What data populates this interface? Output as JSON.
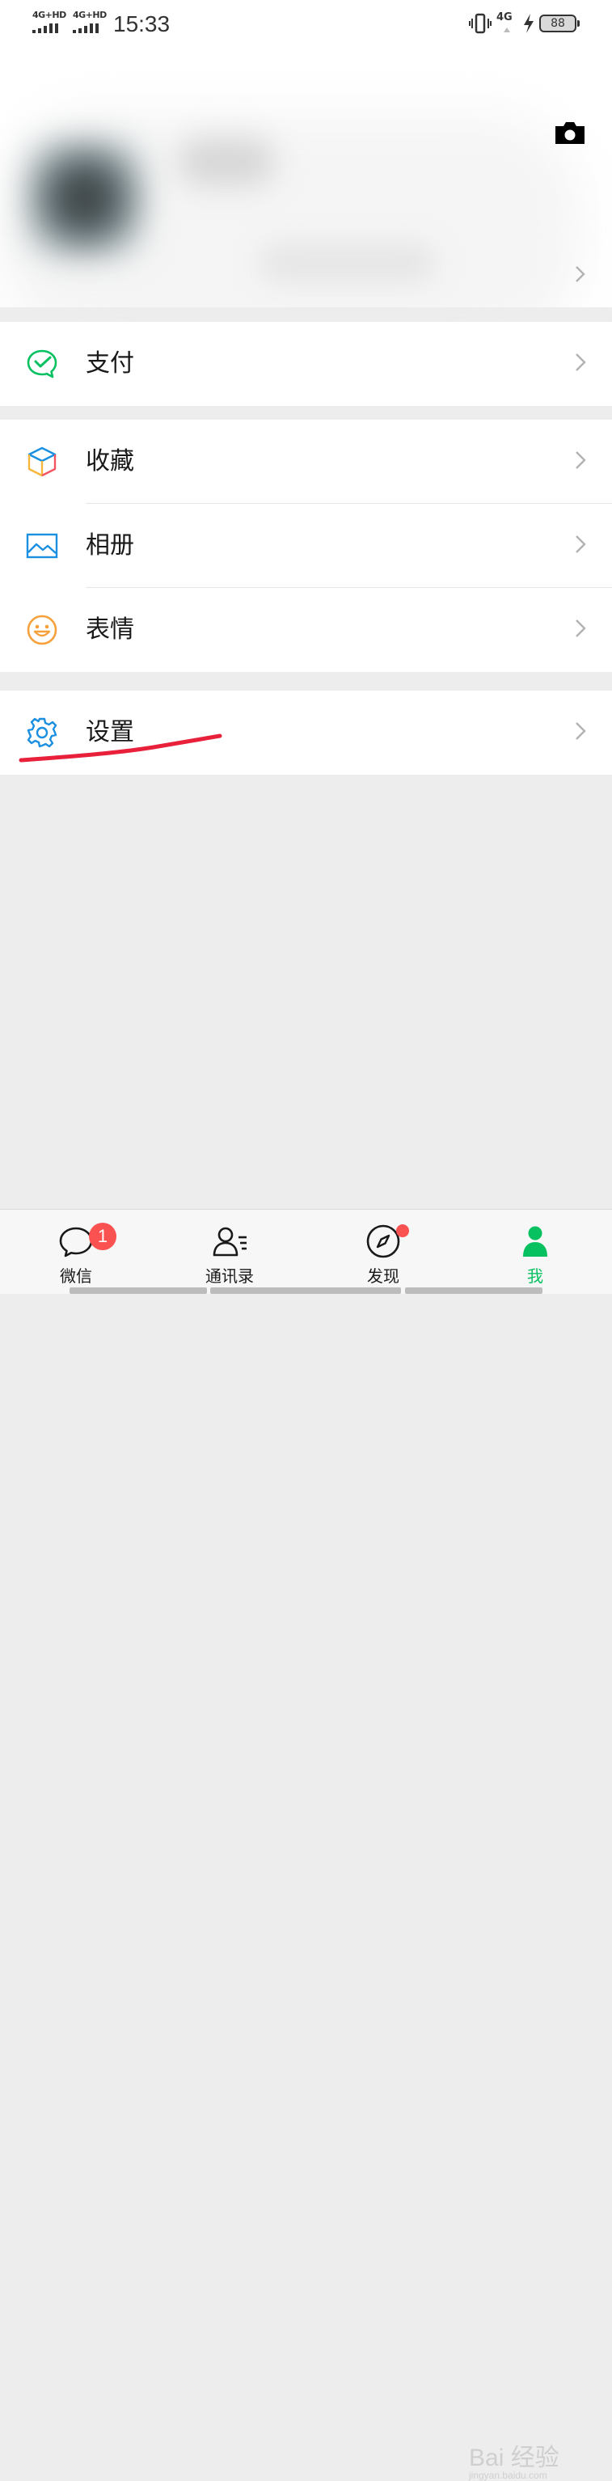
{
  "status_bar": {
    "sim1_network": "4G+HD",
    "sim2_network": "4G+HD",
    "time": "15:33",
    "data_network": "4G",
    "battery_level": "88"
  },
  "menu": {
    "pay_label": "支付",
    "favorites_label": "收藏",
    "album_label": "相册",
    "stickers_label": "表情",
    "settings_label": "设置"
  },
  "tabbar": {
    "tabs": [
      {
        "label": "微信",
        "badge": "1"
      },
      {
        "label": "通讯录"
      },
      {
        "label": "发现",
        "dot": true
      },
      {
        "label": "我",
        "active": true
      }
    ],
    "active_color": "#07c160"
  },
  "watermark": {
    "text": "Bai 经验",
    "url": "jingyan.baidu.com"
  },
  "colors": {
    "accent": "#07c160",
    "badge": "#fa5151",
    "background": "#ededed",
    "annotation": "#e8203a"
  },
  "icons": [
    "camera-icon",
    "pay-icon",
    "favorites-cube-icon",
    "album-icon",
    "stickers-smile-icon",
    "settings-gear-icon",
    "chat-icon",
    "contacts-icon",
    "discover-compass-icon",
    "me-person-icon"
  ]
}
